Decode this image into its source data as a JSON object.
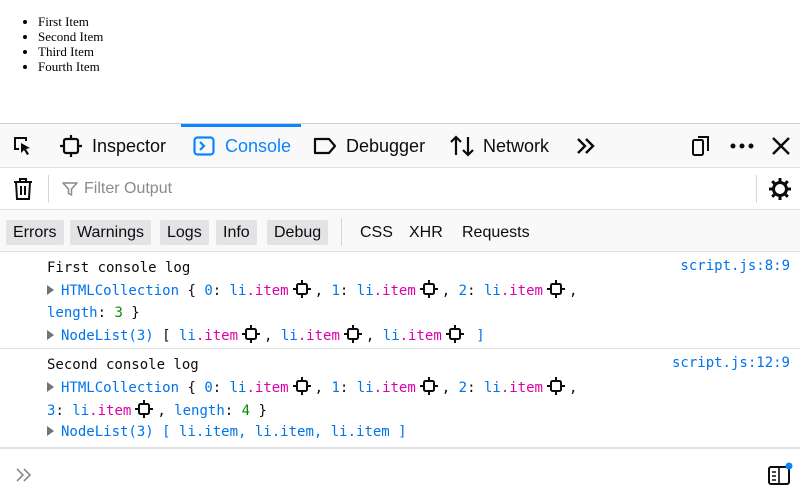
{
  "page": {
    "list_items": [
      "First Item",
      "Second Item",
      "Third Item",
      "Fourth Item"
    ]
  },
  "devtools": {
    "tabs": [
      {
        "label": "Inspector",
        "icon": "inspector-icon"
      },
      {
        "label": "Console",
        "icon": "console-icon",
        "selected": true
      },
      {
        "label": "Debugger",
        "icon": "debugger-icon"
      },
      {
        "label": "Network",
        "icon": "network-icon"
      }
    ],
    "accent_color": "#0a84ff",
    "filter": {
      "placeholder": "Filter Output",
      "value": ""
    },
    "levels": [
      "Errors",
      "Warnings",
      "Logs",
      "Info",
      "Debug"
    ],
    "categories": [
      "CSS",
      "XHR",
      "Requests"
    ],
    "messages": [
      {
        "text": "First console log",
        "source": "script.js:8:9",
        "collection_type": "HTMLCollection",
        "collection_items": [
          {
            "index": "0",
            "tag": "li",
            "cls": ".item"
          },
          {
            "index": "1",
            "tag": "li",
            "cls": ".item"
          },
          {
            "index": "2",
            "tag": "li",
            "cls": ".item"
          }
        ],
        "length_key": "length",
        "length_value": "3",
        "nodelist_type": "NodeList(3)",
        "nodelist_items": [
          {
            "tag": "li",
            "cls": ".item"
          },
          {
            "tag": "li",
            "cls": ".item"
          },
          {
            "tag": "li",
            "cls": ".item"
          }
        ]
      },
      {
        "text": "Second console log",
        "source": "script.js:12:9",
        "collection_type": "HTMLCollection",
        "collection_items": [
          {
            "index": "0",
            "tag": "li",
            "cls": ".item"
          },
          {
            "index": "1",
            "tag": "li",
            "cls": ".item"
          },
          {
            "index": "2",
            "tag": "li",
            "cls": ".item"
          },
          {
            "index": "3",
            "tag": "li",
            "cls": ".item"
          }
        ],
        "length_key": "length",
        "length_value": "4",
        "nodelist_type": "NodeList(3)",
        "nodelist_text": "[ li.item, li.item, li.item ]"
      }
    ]
  }
}
